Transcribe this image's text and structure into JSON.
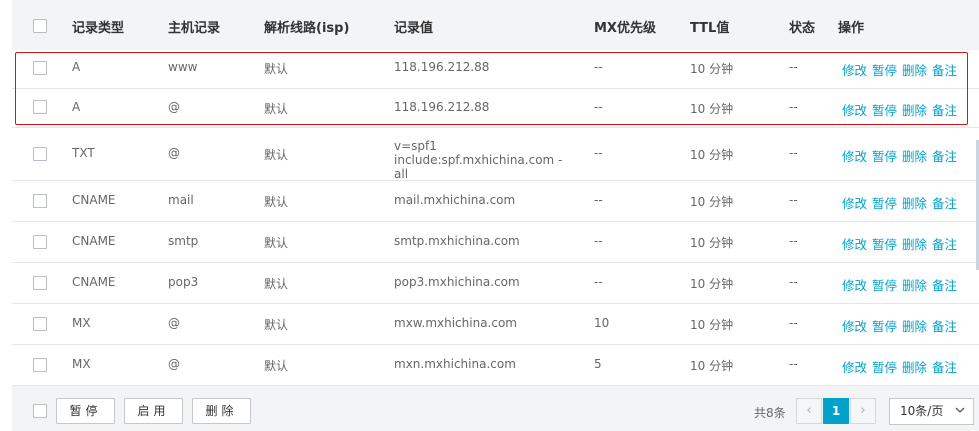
{
  "header": {
    "columns": [
      "记录类型",
      "主机记录",
      "解析线路(isp)",
      "记录值",
      "MX优先级",
      "TTL值",
      "状态",
      "操作"
    ]
  },
  "rows": [
    {
      "type": "A",
      "host": "www",
      "line": "默认",
      "value": "118.196.212.88",
      "mx": "--",
      "ttl": "10 分钟",
      "status": "--"
    },
    {
      "type": "A",
      "host": "@",
      "line": "默认",
      "value": "118.196.212.88",
      "mx": "--",
      "ttl": "10 分钟",
      "status": "--"
    },
    {
      "type": "TXT",
      "host": "@",
      "line": "默认",
      "value": "v=spf1 include:spf.mxhichina.com -all",
      "mx": "--",
      "ttl": "10 分钟",
      "status": "--"
    },
    {
      "type": "CNAME",
      "host": "mail",
      "line": "默认",
      "value": "mail.mxhichina.com",
      "mx": "--",
      "ttl": "10 分钟",
      "status": "--"
    },
    {
      "type": "CNAME",
      "host": "smtp",
      "line": "默认",
      "value": "smtp.mxhichina.com",
      "mx": "--",
      "ttl": "10 分钟",
      "status": "--"
    },
    {
      "type": "CNAME",
      "host": "pop3",
      "line": "默认",
      "value": "pop3.mxhichina.com",
      "mx": "--",
      "ttl": "10 分钟",
      "status": "--"
    },
    {
      "type": "MX",
      "host": "@",
      "line": "默认",
      "value": "mxw.mxhichina.com",
      "mx": "10",
      "ttl": "10 分钟",
      "status": "--"
    },
    {
      "type": "MX",
      "host": "@",
      "line": "默认",
      "value": "mxn.mxhichina.com",
      "mx": "5",
      "ttl": "10 分钟",
      "status": "--"
    }
  ],
  "actions": {
    "edit": "修改",
    "pause": "暂停",
    "delete": "删除",
    "note": "备注"
  },
  "footer": {
    "pause_btn": "暂停",
    "enable_btn": "启用",
    "delete_btn": "删除",
    "total": "共8条",
    "current_page": "1",
    "page_size": "10条/页",
    "prev_glyph": "‹",
    "next_glyph": "›"
  },
  "colors": {
    "link": "#00a2ca",
    "highlight": "#d9141b",
    "active_page": "#00a2ca"
  }
}
